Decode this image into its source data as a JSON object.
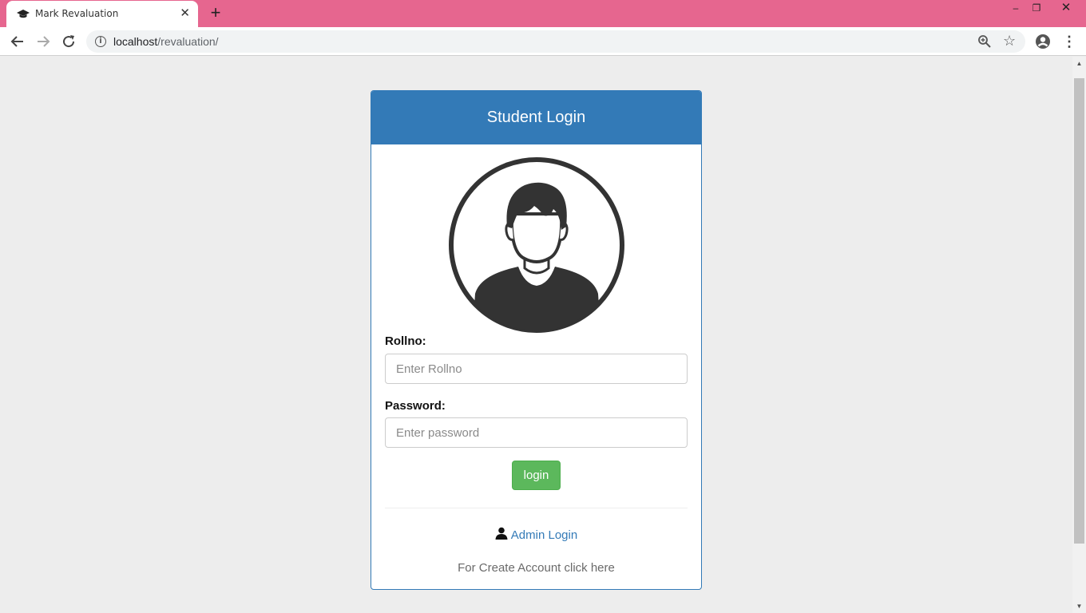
{
  "browser": {
    "tab_title": "Mark Revaluation",
    "tab_close": "✕",
    "new_tab": "+",
    "url_host": "localhost",
    "url_path": "/revaluation/",
    "window_controls": {
      "minimize": "–",
      "restore": "❐",
      "close": "✕"
    },
    "icons": [
      "graduation-cap-icon",
      "back-arrow-icon",
      "forward-arrow-icon",
      "reload-icon",
      "info-icon",
      "zoom-icon",
      "star-icon",
      "account-icon",
      "menu-icon"
    ],
    "theme_color": "#e6668f"
  },
  "login": {
    "heading": "Student Login",
    "rollno_label": "Rollno:",
    "rollno_placeholder": "Enter Rollno",
    "password_label": "Password:",
    "password_placeholder": "Enter password",
    "login_button": "login",
    "admin_link": "Admin Login",
    "create_account": "For Create Account click here",
    "colors": {
      "primary": "#337ab7",
      "success": "#5cb85c"
    }
  }
}
